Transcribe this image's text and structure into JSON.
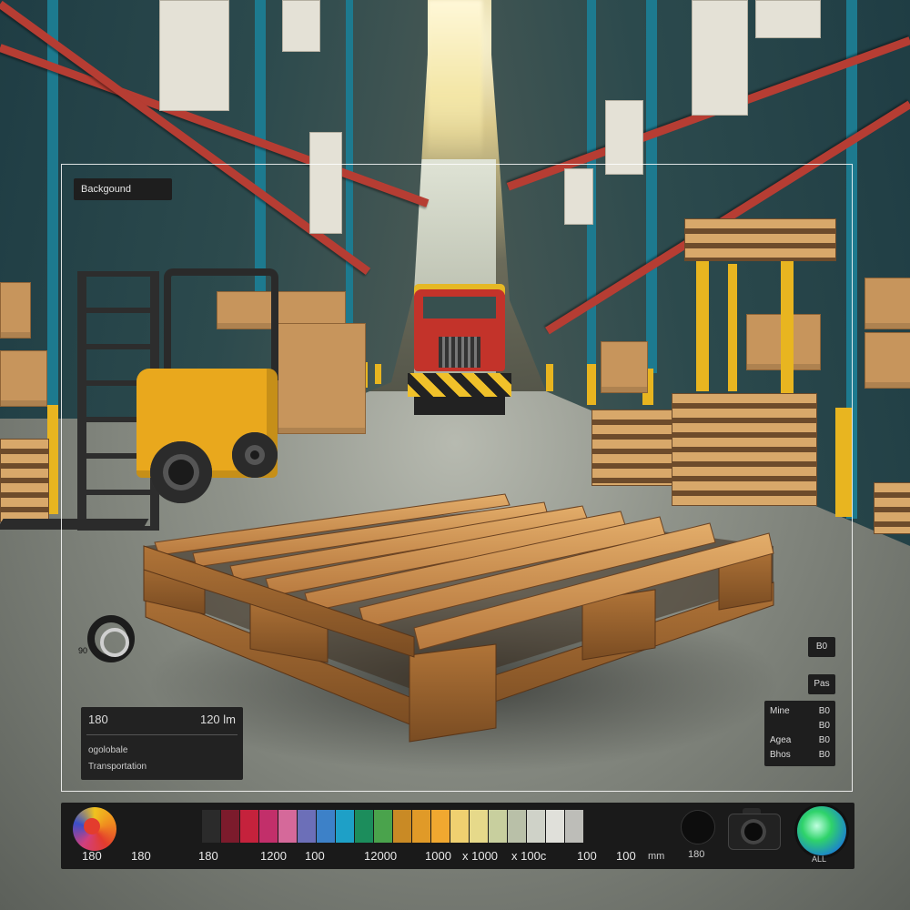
{
  "overlay": {
    "frame_tag": "Backgound",
    "dial_label": "90"
  },
  "info_panel": {
    "value_left": "180",
    "value_right": "120 lm",
    "line_2": "ogolobale",
    "line_3": "Transportation"
  },
  "side_chips": {
    "chip_1": "B0",
    "chip_2": "Pas"
  },
  "side_table": {
    "rows": [
      {
        "label": "Mine",
        "value": "B0"
      },
      {
        "label": "",
        "value": "B0"
      },
      {
        "label": "Agea",
        "value": "B0"
      },
      {
        "label": "Bhos",
        "value": "B0"
      }
    ]
  },
  "toolbar": {
    "labels": [
      "180",
      "180",
      "180",
      "1200",
      "100",
      "12000",
      "1000",
      "x 1000",
      "x 100c",
      "100",
      "100",
      "mm",
      "180",
      "ALL"
    ],
    "swatches": [
      "#2b2b2b",
      "#7c1b2c",
      "#c5223c",
      "#c22f6a",
      "#d5699a",
      "#6c6fb8",
      "#3d81c8",
      "#1ea0c7",
      "#1c8d5c",
      "#4aa34c",
      "#c98a25",
      "#e09a28",
      "#f0a830",
      "#efd070",
      "#e6d98a",
      "#c8cf9e",
      "#b9c0a8",
      "#cfd2c8",
      "#e0e0da",
      "#bdbdb8"
    ]
  }
}
